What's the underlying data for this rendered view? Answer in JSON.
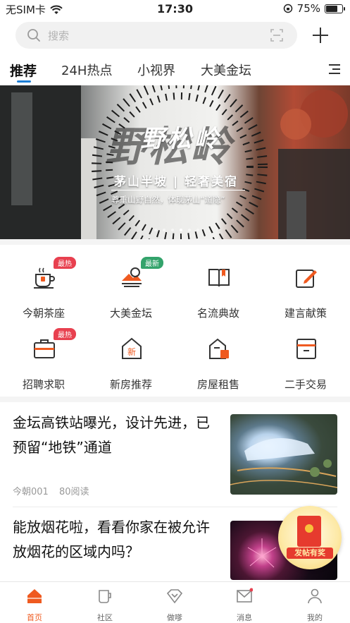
{
  "status_bar": {
    "carrier": "无SIM卡",
    "time": "17:30",
    "battery": "75%",
    "battery_level": 0.75
  },
  "search": {
    "placeholder": "搜索"
  },
  "tabs": [
    {
      "label": "推荐",
      "active": true
    },
    {
      "label": "24H热点"
    },
    {
      "label": "小视界"
    },
    {
      "label": "大美金坛"
    }
  ],
  "banner": {
    "title": "野松岭",
    "subtitle": "茅山半坡 | 轻奢美宿",
    "tagline": "尊重山野自然，体现茅山“道隐”"
  },
  "grid": [
    {
      "label": "今朝茶座",
      "badge": "最热",
      "badge_color": "#e8404f",
      "icon": "tea-cup-icon"
    },
    {
      "label": "大美金坛",
      "badge": "最新",
      "badge_color": "#33a36b",
      "icon": "landscape-icon"
    },
    {
      "label": "名流典故",
      "icon": "book-icon"
    },
    {
      "label": "建言献策",
      "icon": "edit-icon"
    },
    {
      "label": "招聘求职",
      "badge": "最热",
      "badge_color": "#e8404f",
      "icon": "briefcase-icon"
    },
    {
      "label": "新房推荐",
      "icon": "new-house-icon",
      "icon_text": "新"
    },
    {
      "label": "房屋租售",
      "icon": "house-rent-icon"
    },
    {
      "label": "二手交易",
      "icon": "box-icon"
    }
  ],
  "news": [
    {
      "headline": "金坛高铁站曝光，设计先进，已预留“地铁”通道",
      "source": "今朝001",
      "reads": "80阅读"
    },
    {
      "headline": "能放烟花啦，看看你家在被允许放烟花的区域内吗？"
    }
  ],
  "red_packet": {
    "label": "发帖有奖"
  },
  "tab_bar": [
    {
      "label": "首页",
      "active": true,
      "icon": "home-icon"
    },
    {
      "label": "社区",
      "icon": "cup-icon"
    },
    {
      "label": "做嗲",
      "icon": "diamond-icon"
    },
    {
      "label": "消息",
      "icon": "mail-icon"
    },
    {
      "label": "我的",
      "icon": "person-icon"
    }
  ],
  "colors": {
    "accent": "#ef5a20",
    "tab_indicator": "#1e7fd6",
    "badge_red": "#e8404f",
    "badge_green": "#33a36b"
  }
}
